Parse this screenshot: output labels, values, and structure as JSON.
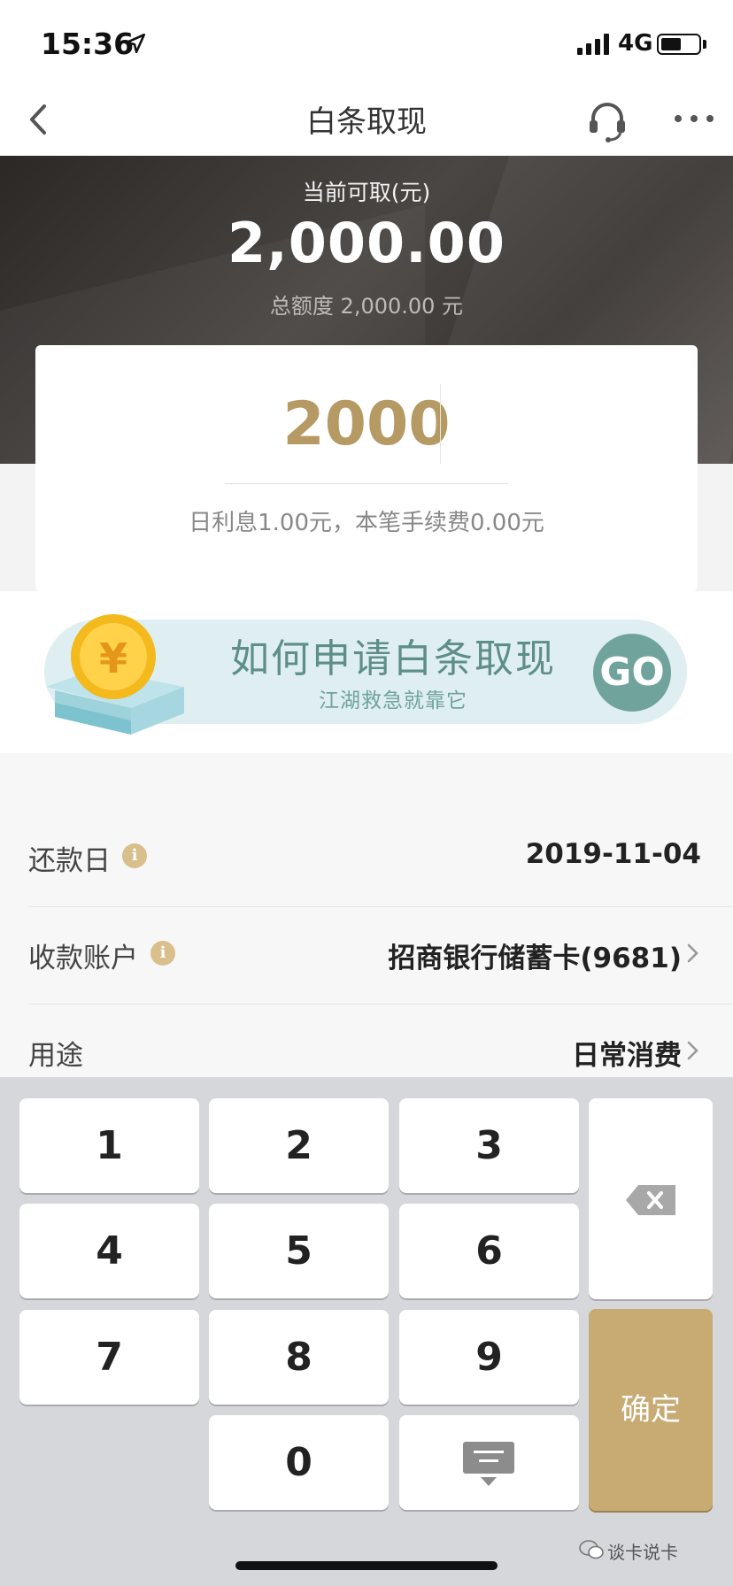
{
  "status_bar": {
    "time": "15:36",
    "network": "4G",
    "icons": [
      "location-arrow-icon",
      "signal-icon",
      "battery-icon"
    ]
  },
  "nav": {
    "title": "白条取现",
    "icons": [
      "back-icon",
      "headset-icon",
      "more-icon"
    ]
  },
  "hero": {
    "label": "当前可取(元)",
    "amount": "2,000.00",
    "total": "总额度 2,000.00 元"
  },
  "amount_card": {
    "value": "2000",
    "fee": "日利息1.00元，本笔手续费0.00元"
  },
  "promo": {
    "title": "如何申请白条取现",
    "subtitle": "江湖救急就靠它",
    "button": "GO",
    "icons": [
      "coin-box-icon"
    ]
  },
  "details": {
    "repay_day": {
      "label": "还款日",
      "value": "2019-11-04"
    },
    "account": {
      "label": "收款账户",
      "value": "招商银行储蓄卡(9681)"
    },
    "purpose": {
      "label": "用途",
      "value": "日常消费"
    }
  },
  "keypad": {
    "keys": [
      "1",
      "2",
      "3",
      "4",
      "5",
      "6",
      "7",
      "8",
      "9",
      "0"
    ],
    "confirm": "确定",
    "icons": [
      "backspace-icon",
      "hide-keyboard-icon"
    ]
  },
  "watermark": "谈卡说卡",
  "colors": {
    "gold": "#b69a64",
    "confirm": "#c8aa73",
    "teal": "#6fa39c",
    "hero_dark": "#2b2826"
  }
}
